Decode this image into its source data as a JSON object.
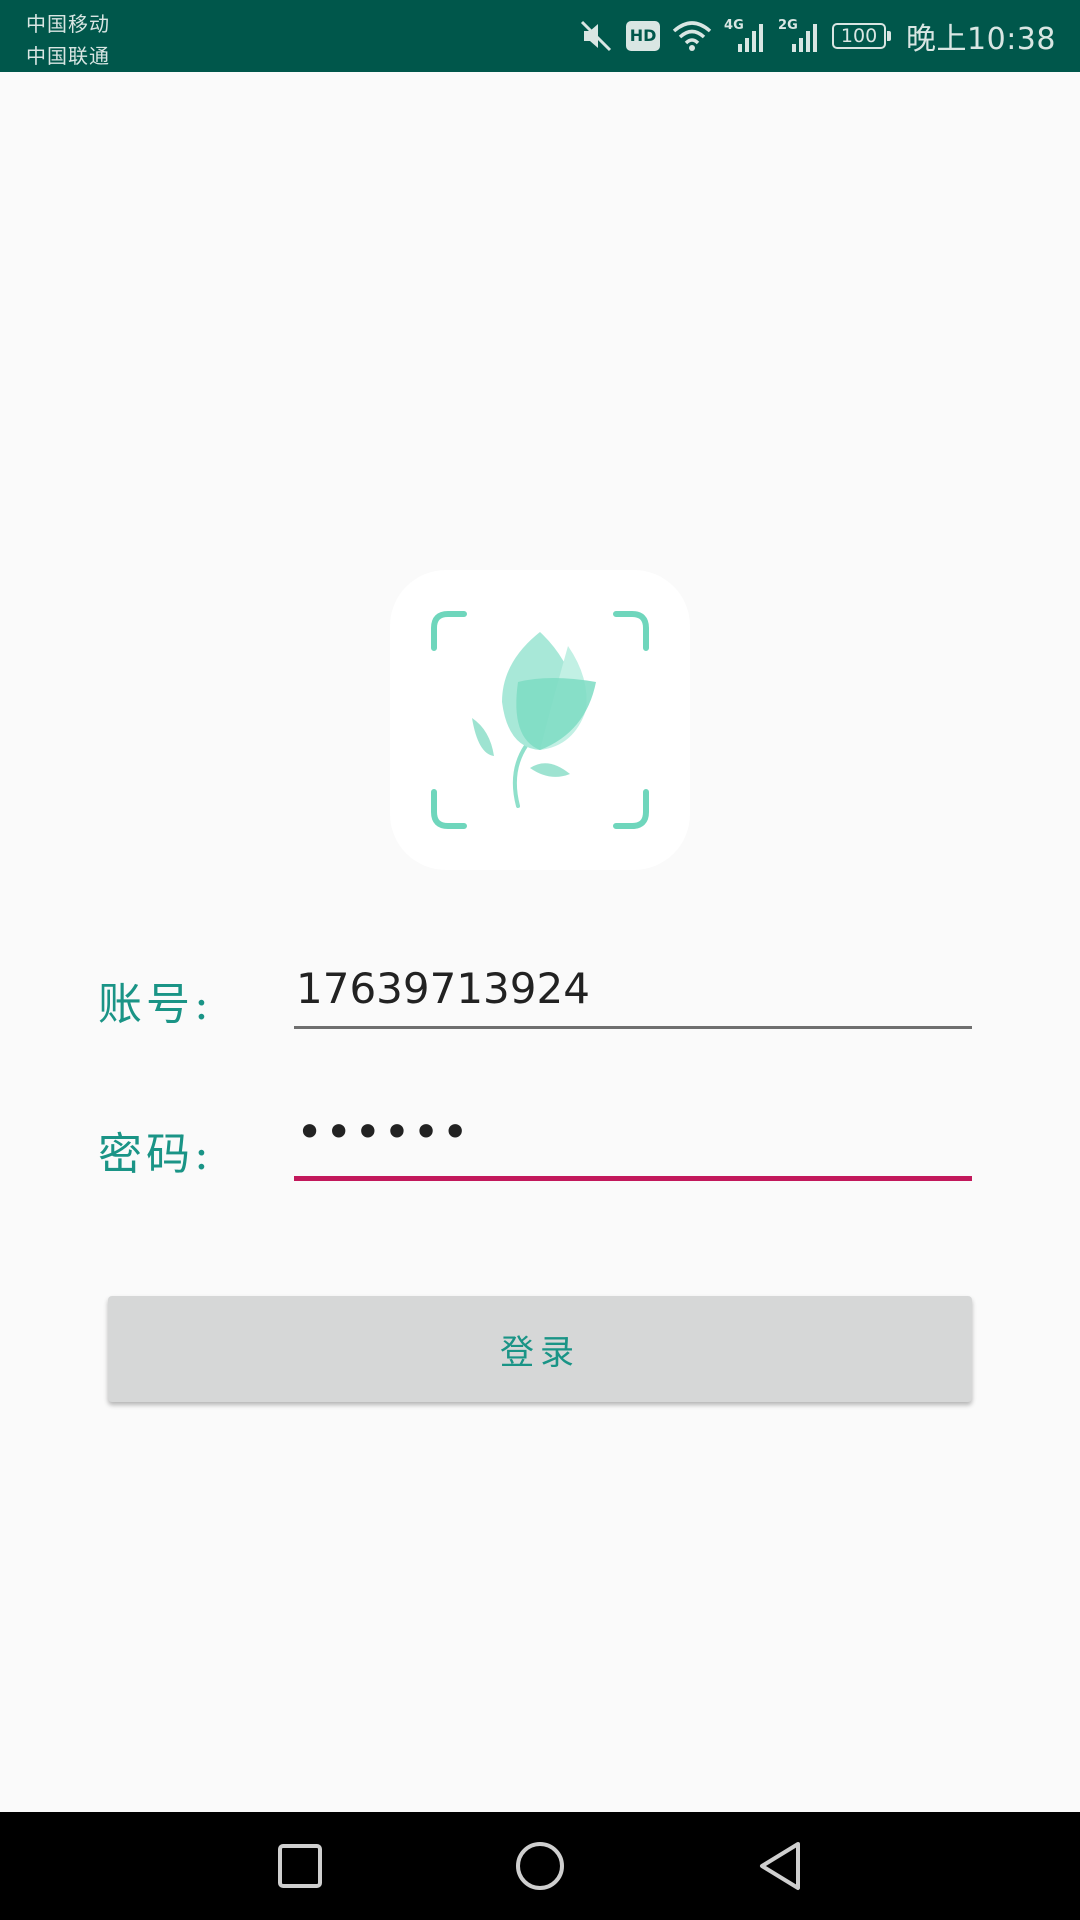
{
  "status_bar": {
    "carrier_1": "中国移动",
    "carrier_2": "中国联通",
    "icons": [
      "mute-icon",
      "hd-icon",
      "wifi-icon",
      "signal-4g-icon",
      "signal-2g-icon"
    ],
    "network_1": "4G",
    "network_2": "2G",
    "hd_label": "HD",
    "battery": "100",
    "time": "晚上10:38",
    "background": "#00574b"
  },
  "logo": {
    "icon": "flower-scan-icon",
    "accent": "#6fd6bc"
  },
  "form": {
    "account_label": "账号:",
    "account_value": "17639713924",
    "password_label": "密码:",
    "password_value": "••••••",
    "label_color": "#1a9486",
    "focus_color": "#c2185b"
  },
  "login_button": {
    "label": "登录"
  },
  "nav_bar": {
    "buttons": [
      "recent-apps-icon",
      "home-icon",
      "back-icon"
    ]
  }
}
